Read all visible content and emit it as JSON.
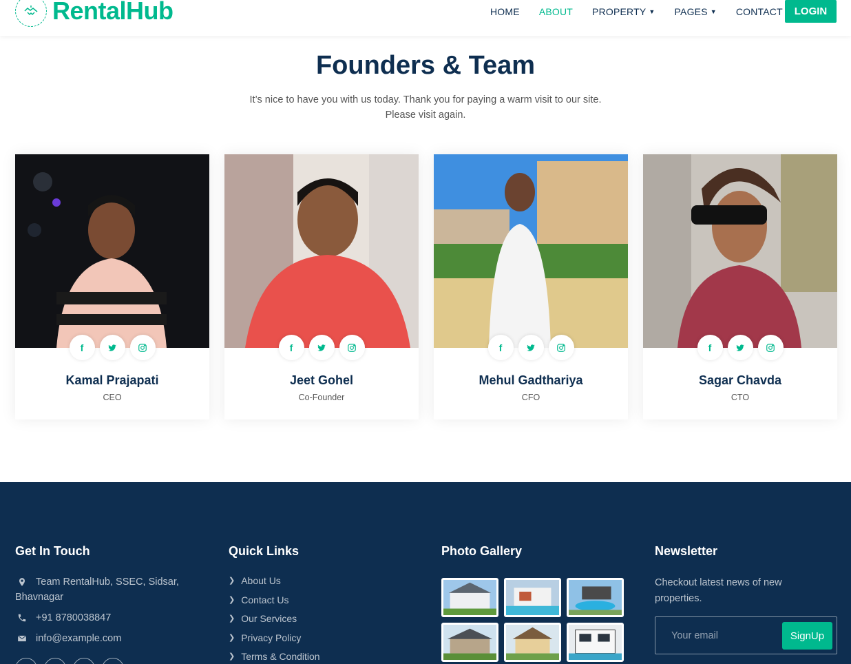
{
  "brand": {
    "name": "RentalHub"
  },
  "nav": {
    "items": [
      {
        "label": "HOME"
      },
      {
        "label": "ABOUT"
      },
      {
        "label": "PROPERTY"
      },
      {
        "label": "PAGES"
      },
      {
        "label": "CONTACT"
      }
    ],
    "active": "ABOUT",
    "login_label": "LOGIN"
  },
  "hero": {
    "title": "Founders & Team",
    "subtitle_line1": "It’s nice to have you with us today. Thank you for paying a warm visit to our site.",
    "subtitle_line2": "Please visit again."
  },
  "team": [
    {
      "name": "Kamal Prajapati",
      "role": "CEO"
    },
    {
      "name": "Jeet Gohel",
      "role": "Co-Founder"
    },
    {
      "name": "Mehul Gadthariya",
      "role": "CFO"
    },
    {
      "name": "Sagar Chavda",
      "role": "CTO"
    }
  ],
  "social_icons": [
    "facebook-icon",
    "twitter-icon",
    "instagram-icon"
  ],
  "footer": {
    "contact": {
      "heading": "Get In Touch",
      "address_line1": "Team RentalHub, SSEC, Sidsar,",
      "address_line2": "Bhavnagar",
      "phone": "+91 8780038847",
      "email": "info@example.com"
    },
    "quick_links": {
      "heading": "Quick Links",
      "items": [
        "About Us",
        "Contact Us",
        "Our Services",
        "Privacy Policy",
        "Terms & Condition"
      ]
    },
    "gallery": {
      "heading": "Photo Gallery"
    },
    "newsletter": {
      "heading": "Newsletter",
      "text_line1": "Checkout latest news of new",
      "text_line2": "properties.",
      "placeholder": "Your email",
      "button": "SignUp"
    }
  },
  "colors": {
    "accent": "#00b98e",
    "dark": "#0e2e50"
  }
}
